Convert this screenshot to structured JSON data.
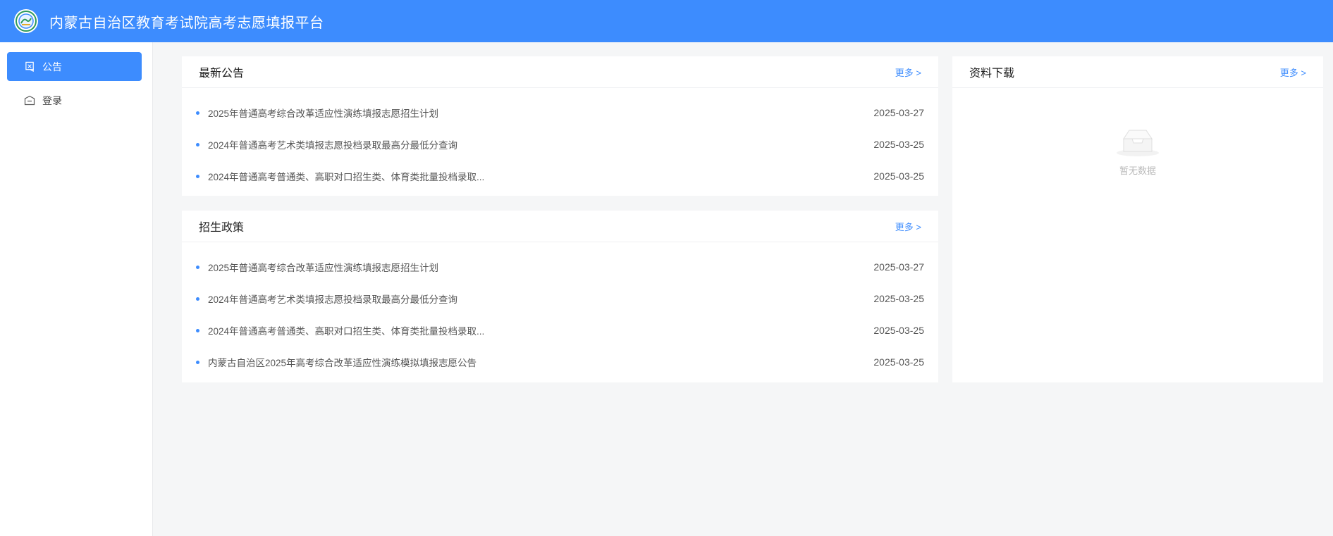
{
  "header": {
    "title": "内蒙古自治区教育考试院高考志愿填报平台",
    "logo_icon": "logo-emblem"
  },
  "sidebar": {
    "items": [
      {
        "label": "公告",
        "icon": "notice-icon",
        "active": true
      },
      {
        "label": "登录",
        "icon": "login-icon",
        "active": false
      }
    ]
  },
  "latest_notices": {
    "title": "最新公告",
    "more_label": "更多 >",
    "items": [
      {
        "title": "2025年普通高考综合改革适应性演练填报志愿招生计划",
        "date": "2025-03-27"
      },
      {
        "title": "2024年普通高考艺术类填报志愿投档录取最高分最低分查询",
        "date": "2025-03-25"
      },
      {
        "title": "2024年普通高考普通类、高职对口招生类、体育类批量投档录取...",
        "date": "2025-03-25"
      }
    ]
  },
  "policy": {
    "title": "招生政策",
    "more_label": "更多 >",
    "items": [
      {
        "title": "2025年普通高考综合改革适应性演练填报志愿招生计划",
        "date": "2025-03-27"
      },
      {
        "title": "2024年普通高考艺术类填报志愿投档录取最高分最低分查询",
        "date": "2025-03-25"
      },
      {
        "title": "2024年普通高考普通类、高职对口招生类、体育类批量投档录取...",
        "date": "2025-03-25"
      },
      {
        "title": "内蒙古自治区2025年高考综合改革适应性演练模拟填报志愿公告",
        "date": "2025-03-25"
      }
    ]
  },
  "downloads": {
    "title": "资料下载",
    "more_label": "更多 >",
    "empty_text": "暂无数据",
    "empty_icon": "empty-inbox-icon"
  },
  "colors": {
    "accent": "#3d8cfe",
    "background": "#f5f6f7"
  }
}
